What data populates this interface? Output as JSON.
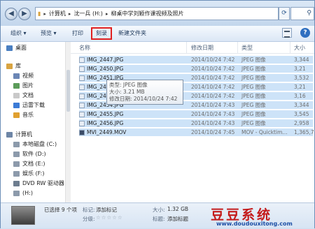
{
  "address": {
    "segments": [
      "计算机",
      "沈一兵 (H:)",
      "柳桌中学刘颖作课视频及照片"
    ],
    "search_placeholder": ""
  },
  "toolbar": {
    "organize": "组织 ▾",
    "preview": "预览 ▾",
    "print": "打印",
    "burn": "刻录",
    "new_folder": "新建文件夹"
  },
  "sidebar": {
    "items": [
      {
        "label": "桌面",
        "icon": "desktop-icon",
        "color": "#4a7fc1"
      },
      {
        "label": "库",
        "icon": "library-icon",
        "color": "#d9a441"
      },
      {
        "label": "视频",
        "icon": "video-icon",
        "color": "#6b86b5"
      },
      {
        "label": "图片",
        "icon": "picture-icon",
        "color": "#5c9c5a"
      },
      {
        "label": "文档",
        "icon": "document-icon",
        "color": "#c9c9c9"
      },
      {
        "label": "迅雷下载",
        "icon": "thunder-icon",
        "color": "#3b7bd6"
      },
      {
        "label": "音乐",
        "icon": "music-icon",
        "color": "#e0a030"
      },
      {
        "label": "计算机",
        "icon": "computer-icon",
        "color": "#6e86a6"
      },
      {
        "label": "本地磁盘 (C:)",
        "icon": "drive-icon",
        "color": "#8c9aab"
      },
      {
        "label": "软件 (D:)",
        "icon": "drive-icon",
        "color": "#8c9aab"
      },
      {
        "label": "文档 (E:)",
        "icon": "drive-icon",
        "color": "#8c9aab"
      },
      {
        "label": "娱乐 (F:)",
        "icon": "drive-icon",
        "color": "#8c9aab"
      },
      {
        "label": "DVD RW 驱动器",
        "icon": "dvd-drive-icon",
        "color": "#6d7d8f"
      },
      {
        "label": "(H:)",
        "icon": "removable-drive-icon",
        "color": "#8c9aab"
      }
    ]
  },
  "columns": {
    "name": "名称",
    "modified": "修改日期",
    "type": "类型",
    "size": "大小"
  },
  "files": [
    {
      "name": "IMG_2447.JPG",
      "date": "2014/10/24 7:42",
      "type": "JPEG 图像",
      "size": "3,344"
    },
    {
      "name": "IMG_2450.JPG",
      "date": "2014/10/24 7:42",
      "type": "JPEG 图像",
      "size": "3,21"
    },
    {
      "name": "IMG_2451.JPG",
      "date": "2014/10/24 7:42",
      "type": "JPEG 图像",
      "size": "3,532"
    },
    {
      "name": "IMG_2452.JPG",
      "date": "2014/10/24 7:42",
      "type": "JPEG 图像",
      "size": "3,21"
    },
    {
      "name": "IMG_2453.JPG",
      "date": "2014/10/24 7:42",
      "type": "JPEG 图像",
      "size": "3,16"
    },
    {
      "name": "IMG_2454.JPG",
      "date": "2014/10/24 7:43",
      "type": "JPEG 图像",
      "size": "3,344"
    },
    {
      "name": "IMG_2455.JPG",
      "date": "2014/10/24 7:43",
      "type": "JPEG 图像",
      "size": "3,545"
    },
    {
      "name": "IMG_2456.JPG",
      "date": "2014/10/24 7:43",
      "type": "JPEG 图像",
      "size": "2,958"
    },
    {
      "name": "MVI_2449.MOV",
      "date": "2014/10/24 7:45",
      "type": "MOV - Quicktim...",
      "size": "1,365,70"
    }
  ],
  "tooltip": {
    "type": "类型: JPEG 图像",
    "size": "大小: 3.21 MB",
    "modified": "修改日期: 2014/10/24 7:42"
  },
  "details": {
    "selected": "已选择 9 个项",
    "tags_label": "标记:",
    "tags_value": "添加标记",
    "rating_label": "分级:",
    "rating_stars": "☆☆☆☆☆",
    "size_label": "大小:",
    "size_value": "1.32 GB",
    "title_label": "标题:",
    "title_value": "添加标题"
  },
  "watermark": {
    "title": "豆豆系统",
    "url": "www.doudouxitong.com"
  }
}
